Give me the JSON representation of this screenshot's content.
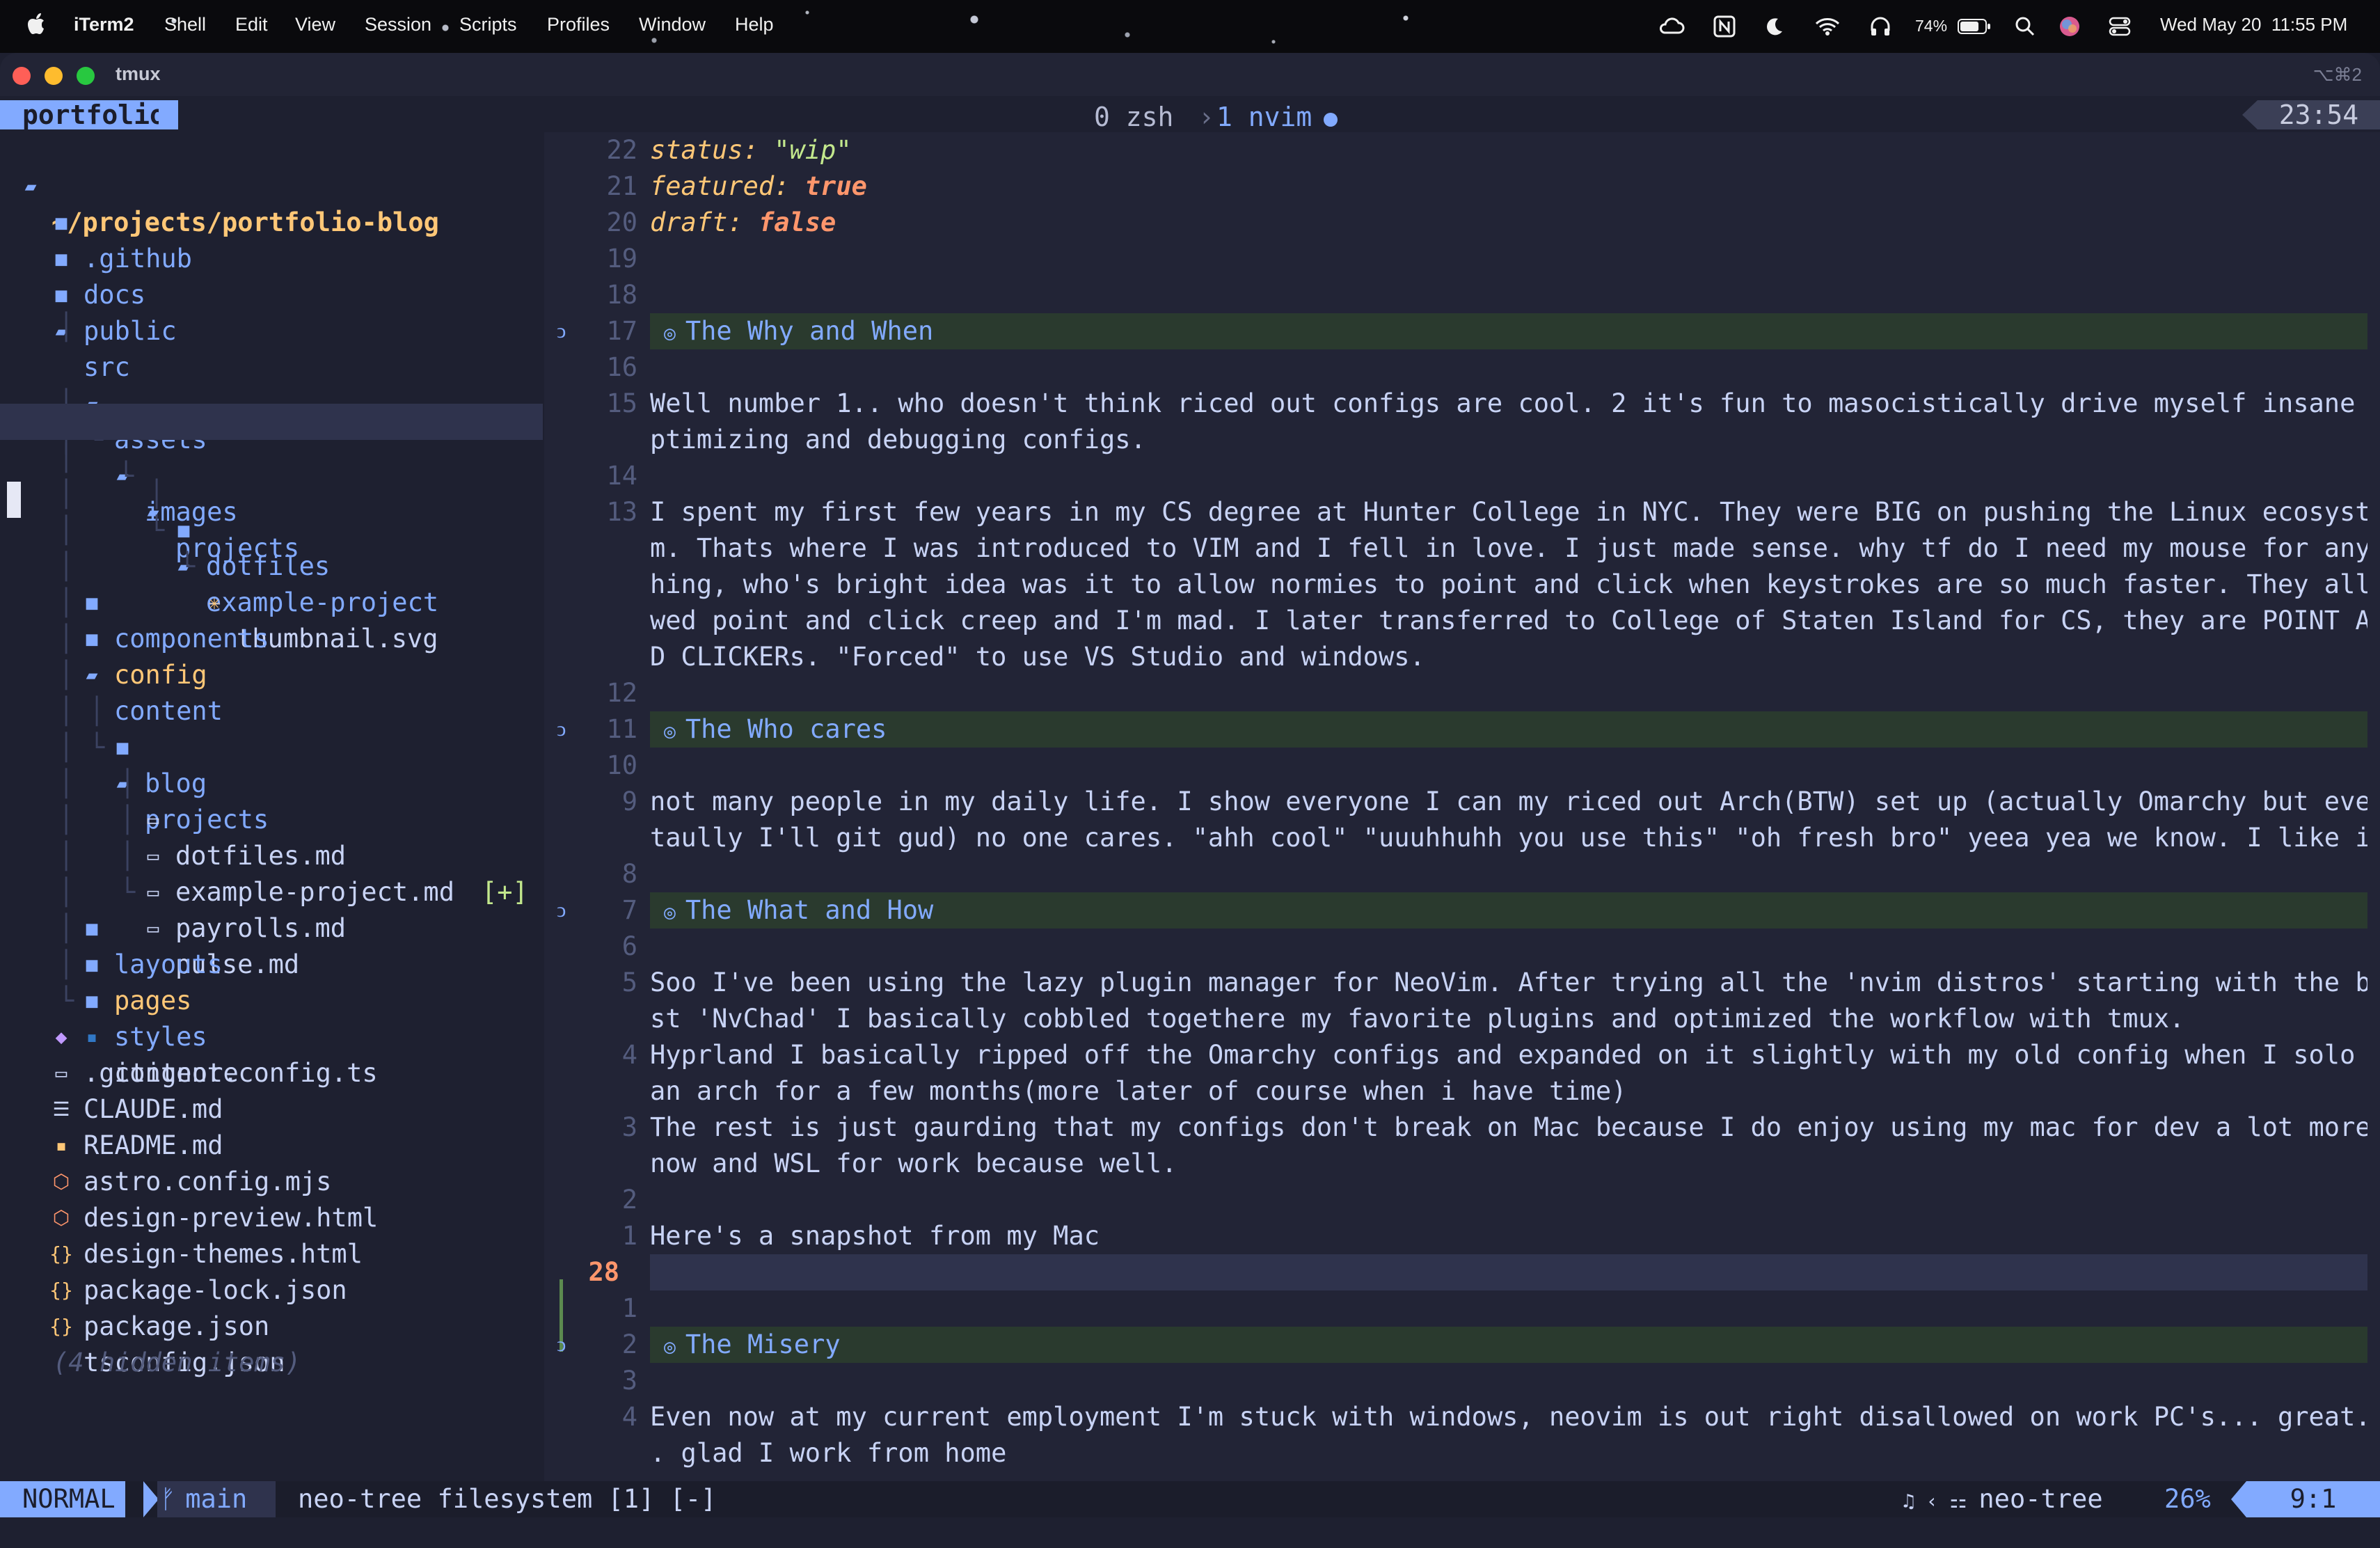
{
  "menubar": {
    "app": "iTerm2",
    "items": [
      "Shell",
      "Edit",
      "View",
      "Session",
      "Scripts",
      "Profiles",
      "Window",
      "Help"
    ],
    "battery": "74%",
    "datetime": "Wed May 20  11:55 PM"
  },
  "window": {
    "title": "tmux",
    "shortcut": "⌥⌘2"
  },
  "tmux": {
    "session": "portfolio",
    "windows": [
      {
        "label": "0 zsh"
      },
      {
        "label": "1 nvim"
      }
    ],
    "clock": "23:54"
  },
  "tree": {
    "root": "~/projects/portfolio-blog",
    "items": [
      {
        "label": ".github"
      },
      {
        "label": "docs"
      },
      {
        "label": "public"
      },
      {
        "label": "src"
      },
      {
        "label": "assets"
      },
      {
        "label": "images"
      },
      {
        "label": "projects"
      },
      {
        "label": "dotfiles"
      },
      {
        "label": "example-project"
      },
      {
        "label": "thumbnail.svg"
      },
      {
        "label": "components"
      },
      {
        "label": "config"
      },
      {
        "label": "content"
      },
      {
        "label": "blog"
      },
      {
        "label": "projects"
      },
      {
        "label": "dotfiles.md",
        "status": "[+]"
      },
      {
        "label": "example-project.md"
      },
      {
        "label": "payrolls.md"
      },
      {
        "label": "pulse.md"
      },
      {
        "label": "layouts"
      },
      {
        "label": "pages"
      },
      {
        "label": "styles"
      },
      {
        "label": "content.config.ts"
      },
      {
        "label": ".gitignore"
      },
      {
        "label": "CLAUDE.md"
      },
      {
        "label": "README.md"
      },
      {
        "label": "astro.config.mjs"
      },
      {
        "label": "design-preview.html"
      },
      {
        "label": "design-themes.html"
      },
      {
        "label": "package-lock.json"
      },
      {
        "label": "package.json"
      },
      {
        "label": "tsconfig.json"
      },
      {
        "label": "(4 hidden items)"
      }
    ]
  },
  "editor": {
    "frontmatter": [
      {
        "ln": "22",
        "key": "status:",
        "value": "\"wip\""
      },
      {
        "ln": "21",
        "key": "featured:",
        "value": "true"
      },
      {
        "ln": "20",
        "key": "draft:",
        "value": "false"
      }
    ],
    "lines": [
      {
        "ln": "19",
        "text": ""
      },
      {
        "ln": "18",
        "text": ""
      },
      {
        "ln": "17",
        "text": "The Why and When",
        "heading": true
      },
      {
        "ln": "16",
        "text": ""
      },
      {
        "ln": "15",
        "text": "Well number 1.. who doesn't think riced out configs are cool. 2 it's fun to masocistically drive myself insane o"
      },
      {
        "ln": "",
        "text": "ptimizing and debugging configs."
      },
      {
        "ln": "14",
        "text": ""
      },
      {
        "ln": "13",
        "text": "I spent my first few years in my CS degree at Hunter College in NYC. They were BIG on pushing the Linux ecosyste"
      },
      {
        "ln": "",
        "text": "m. Thats where I was introduced to VIM and I fell in love. I just made sense. why tf do I need my mouse for anyt"
      },
      {
        "ln": "",
        "text": "hing, who's bright idea was it to allow normies to point and click when keystrokes are so much faster. They allo"
      },
      {
        "ln": "",
        "text": "wed point and click creep and I'm mad. I later transferred to College of Staten Island for CS, they are POINT AN"
      },
      {
        "ln": "",
        "text": "D CLICKERs. \"Forced\" to use VS Studio and windows."
      },
      {
        "ln": "12",
        "text": ""
      },
      {
        "ln": "11",
        "text": "The Who cares",
        "heading": true
      },
      {
        "ln": "10",
        "text": ""
      },
      {
        "ln": "9",
        "text": "not many people in my daily life. I show everyone I can my riced out Arch(BTW) set up (actually Omarchy but even"
      },
      {
        "ln": "",
        "text": "taully I'll git gud) no one cares. \"ahh cool\" \"uuuhhuhh you use this\" \"oh fresh bro\" yeea yea we know. I like it"
      },
      {
        "ln": "8",
        "text": ""
      },
      {
        "ln": "7",
        "text": "The What and How",
        "heading": true
      },
      {
        "ln": "6",
        "text": ""
      },
      {
        "ln": "5",
        "text": "Soo I've been using the lazy plugin manager for NeoVim. After trying all the 'nvim distros' starting with the be"
      },
      {
        "ln": "",
        "text": "st 'NvChad' I basically cobbled togethere my favorite plugins and optimized the workflow with tmux."
      },
      {
        "ln": "4",
        "text": "Hyprland I basically ripped off the Omarchy configs and expanded on it slightly with my old config when I solo r"
      },
      {
        "ln": "",
        "text": "an arch for a few months(more later of course when i have time)"
      },
      {
        "ln": "3",
        "text": "The rest is just gaurding that my configs don't break on Mac because I do enjoy using my mac for dev a lot more"
      },
      {
        "ln": "",
        "text": "now and WSL for work because well."
      },
      {
        "ln": "2",
        "text": ""
      },
      {
        "ln": "1",
        "text": "Here's a snapshot from my Mac"
      },
      {
        "ln": "28",
        "text": "",
        "current": true
      },
      {
        "ln": "1",
        "text": ""
      },
      {
        "ln": "2",
        "text": "The Misery",
        "heading": true
      },
      {
        "ln": "3",
        "text": ""
      },
      {
        "ln": "4",
        "text": "Even now at my current employment I'm stuck with windows, neovim is out right disallowed on work PC's... great.."
      },
      {
        "ln": "",
        "text": ". glad I work from home"
      }
    ]
  },
  "statusline": {
    "mode": "NORMAL",
    "branch": "main",
    "file": "neo-tree filesystem [1] [-]",
    "filetype": "neo-tree",
    "percent": "26%",
    "position": "9:1"
  },
  "icons": {
    "folder": "folder-icon",
    "folder_open": "folder-open-icon",
    "markdown": "markdown-icon",
    "typescript": "typescript-icon",
    "json": "json-icon",
    "html": "html-icon",
    "git": "git-icon",
    "branch": "branch-icon"
  },
  "colors": {
    "accent": "#82aaff",
    "folder_highlight": "#ffc777",
    "heading_bg": "#2a3a2e",
    "editor_bg": "#222436",
    "tree_bg": "#1e2030"
  }
}
